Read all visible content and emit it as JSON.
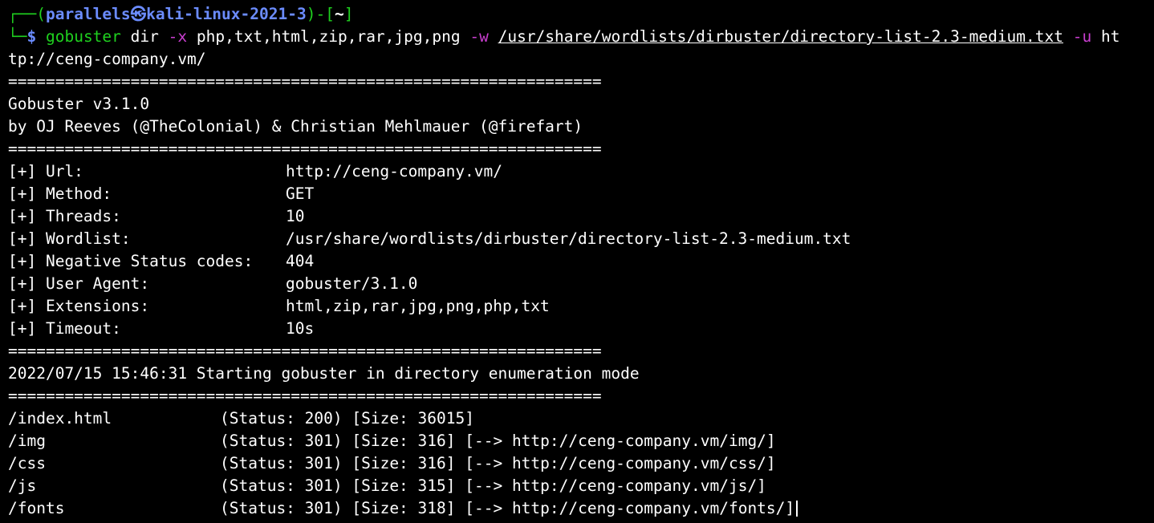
{
  "prompt": {
    "box_top": "┌──(",
    "user_host": "parallels㉿kali-linux-2021-3",
    "sep": ")-[",
    "cwd": "~",
    "close": "]",
    "box_bottom": "└─",
    "symbol": "$"
  },
  "command": {
    "program": "gobuster",
    "mode": "dir",
    "flag_x": "-x",
    "extensions_arg": "php,txt,html,zip,rar,jpg,png",
    "flag_w": "-w",
    "wordlist_arg": "/usr/share/wordlists/dirbuster/directory-list-2.3-medium.txt",
    "flag_u": "-u",
    "url_arg_part1": "ht",
    "url_arg_part2": "tp://ceng-company.vm/"
  },
  "separator": "===============================================================",
  "banner": {
    "version": "Gobuster v3.1.0",
    "authors": "by OJ Reeves (@TheColonial) & Christian Mehlmauer (@firefart)"
  },
  "config": [
    {
      "label": "[+] Url:",
      "value": "http://ceng-company.vm/"
    },
    {
      "label": "[+] Method:",
      "value": "GET"
    },
    {
      "label": "[+] Threads:",
      "value": "10"
    },
    {
      "label": "[+] Wordlist:",
      "value": "/usr/share/wordlists/dirbuster/directory-list-2.3-medium.txt"
    },
    {
      "label": "[+] Negative Status codes:",
      "value": "404"
    },
    {
      "label": "[+] User Agent:",
      "value": "gobuster/3.1.0"
    },
    {
      "label": "[+] Extensions:",
      "value": "html,zip,rar,jpg,png,php,txt"
    },
    {
      "label": "[+] Timeout:",
      "value": "10s"
    }
  ],
  "start_message": "2022/07/15 15:46:31 Starting gobuster in directory enumeration mode",
  "results": [
    {
      "path": "/index.html",
      "info": "(Status: 200) [Size: 36015]"
    },
    {
      "path": "/img",
      "info": "(Status: 301) [Size: 316] [--> http://ceng-company.vm/img/]"
    },
    {
      "path": "/css",
      "info": "(Status: 301) [Size: 316] [--> http://ceng-company.vm/css/]"
    },
    {
      "path": "/js",
      "info": "(Status: 301) [Size: 315] [--> http://ceng-company.vm/js/]"
    },
    {
      "path": "/fonts",
      "info": "(Status: 301) [Size: 318] [--> http://ceng-company.vm/fonts/]"
    }
  ],
  "colors": {
    "background": "#000000",
    "prompt_green": "#1fd11f",
    "prompt_blue": "#6b8cff",
    "flag_magenta": "#c93ecf",
    "text": "#ffffff"
  }
}
